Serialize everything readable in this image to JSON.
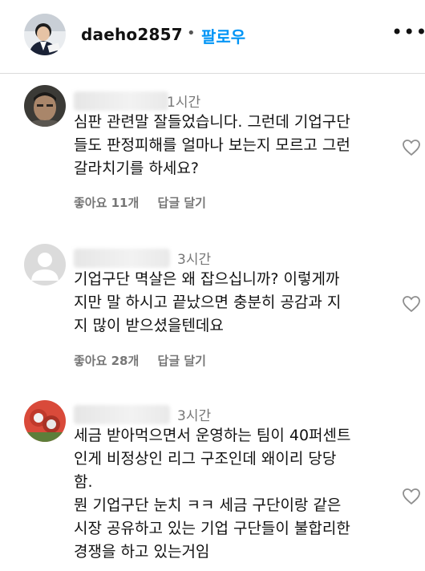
{
  "header": {
    "username": "daeho2857",
    "separator": "•",
    "follow_label": "팔로우",
    "more_label": "•••"
  },
  "comments": [
    {
      "time": "1시간",
      "text": "심판 관련말 잘들었습니다. 그런데 기업구단\n들도 판정피해를 얼마나 보는지 모르고 그런\n갈라치기를 하세요?",
      "likes": "좋아요 11개",
      "reply": "답글 달기"
    },
    {
      "time": "3시간",
      "text": "기업구단 멱살은 왜 잡으십니까? 이렇게까\n지만 말 하시고 끝났으면 충분히 공감과 지\n지 많이 받으셨을텐데요",
      "likes": "좋아요 28개",
      "reply": "답글 달기"
    },
    {
      "time": "3시간",
      "text": "세금 받아먹으면서 운영하는 팀이 40퍼센트\n인게 비정상인 리그 구조인데 왜이리 당당\n함.\n뭔 기업구단 눈치 ㅋㅋ 세금 구단이랑 같은\n시장 공유하고 있는 기업 구단들이 불합리한\n경쟁을 하고 있는거임"
    }
  ],
  "colors": {
    "link": "#0095f6",
    "secondary_text": "#777777"
  }
}
